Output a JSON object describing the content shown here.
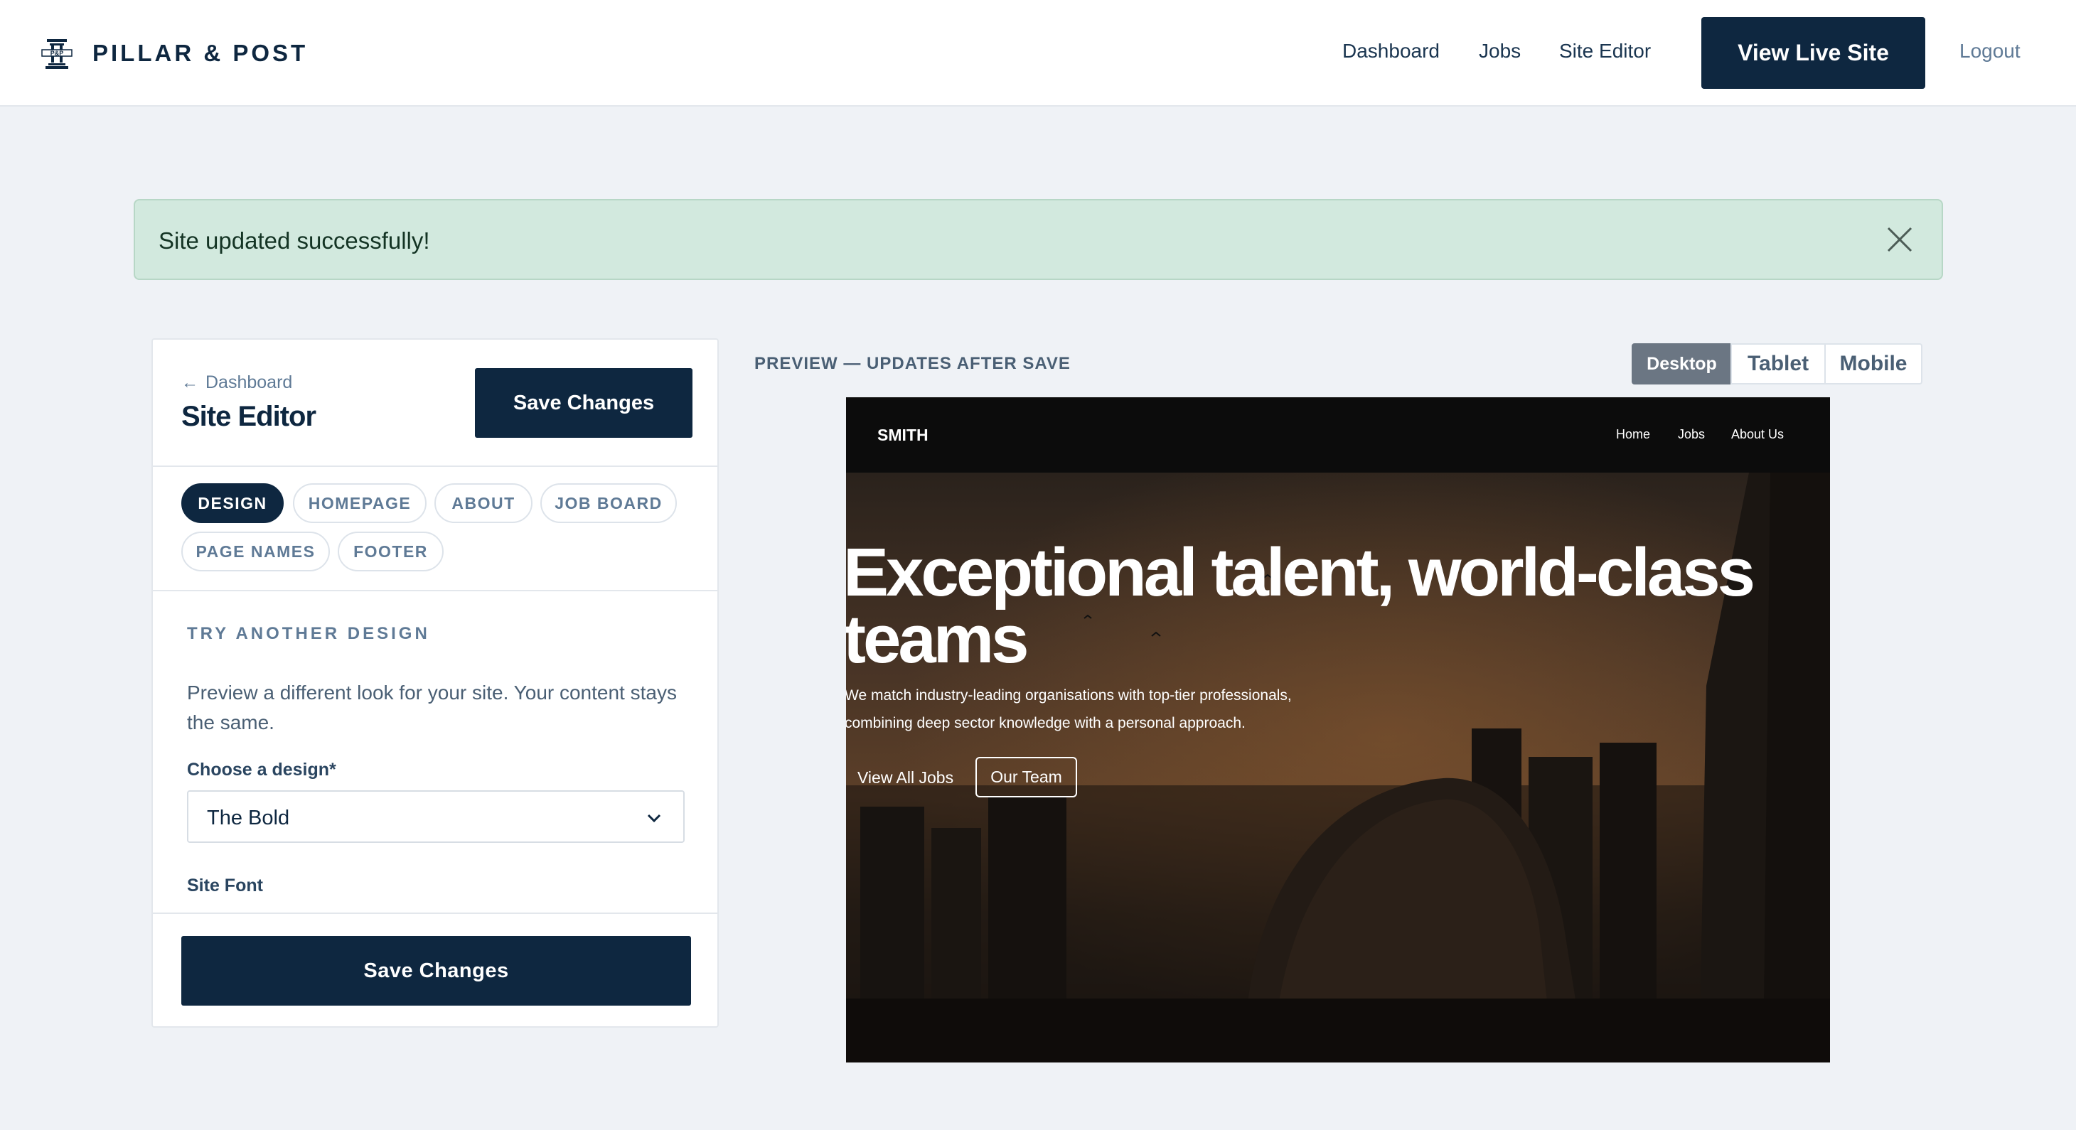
{
  "brand": {
    "name": "PILLAR & POST",
    "logo_icon": "pillar-post-monogram-icon"
  },
  "nav": {
    "dashboard": "Dashboard",
    "jobs": "Jobs",
    "site_editor": "Site Editor",
    "view_live_site": "View Live Site",
    "logout": "Logout"
  },
  "alert": {
    "message": "Site updated successfully!",
    "close_icon": "close-icon",
    "background": "#d2e9de"
  },
  "editor": {
    "back_label": "Dashboard",
    "back_icon": "arrow-left-icon",
    "title": "Site Editor",
    "save_top": "Save Changes",
    "tabs": [
      {
        "label": "DESIGN",
        "active": true
      },
      {
        "label": "HOMEPAGE",
        "active": false
      },
      {
        "label": "ABOUT",
        "active": false
      },
      {
        "label": "JOB BOARD",
        "active": false
      },
      {
        "label": "PAGE NAMES",
        "active": false
      },
      {
        "label": "FOOTER",
        "active": false
      }
    ],
    "section_heading": "TRY ANOTHER DESIGN",
    "section_description": "Preview a different look for your site. Your content stays the same.",
    "design_label": "Choose a design*",
    "design_value": "The Bold",
    "design_chevron_icon": "chevron-down-icon",
    "font_label": "Site Font",
    "save_bottom": "Save Changes"
  },
  "preview": {
    "label": "PREVIEW — UPDATES AFTER SAVE",
    "devices": [
      {
        "label": "Desktop",
        "active": true
      },
      {
        "label": "Tablet",
        "active": false
      },
      {
        "label": "Mobile",
        "active": false
      }
    ],
    "site": {
      "logo": "SMITH",
      "nav": [
        "Home",
        "Jobs",
        "About Us"
      ],
      "hero_title": "Exceptional talent, world-class teams",
      "hero_subtitle": "We match industry-leading organisations with top-tier professionals, combining deep sector knowledge with a personal approach.",
      "cta_primary": "View All Jobs",
      "cta_secondary": "Our Team"
    }
  },
  "colors": {
    "primary": "#0e2740",
    "muted": "#5f7a96",
    "page_background": "#eff2f6",
    "success_background": "#d2e9de"
  }
}
